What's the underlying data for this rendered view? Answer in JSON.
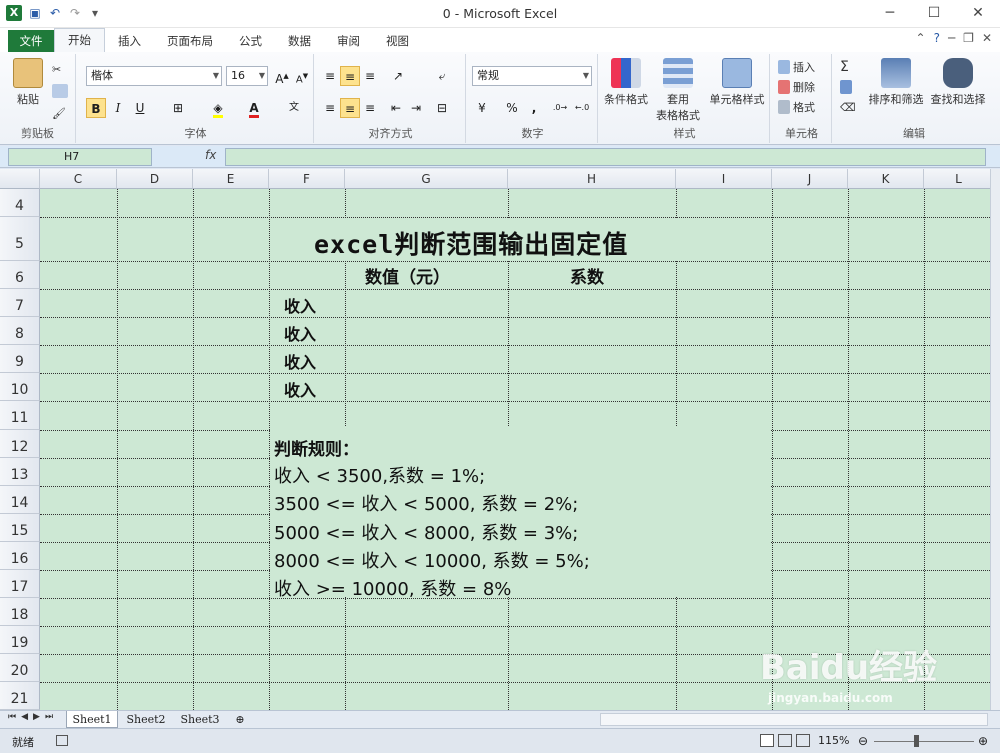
{
  "window": {
    "title": "0  -  Microsoft Excel",
    "controls": [
      "─",
      "☐",
      "✕"
    ]
  },
  "ribbon_tabs": [
    "文件",
    "开始",
    "插入",
    "页面布局",
    "公式",
    "数据",
    "审阅",
    "视图"
  ],
  "ribbon": {
    "clipboard": {
      "paste": "粘贴",
      "label": "剪贴板"
    },
    "font": {
      "name": "楷体",
      "size": "16",
      "label": "字体",
      "bold": "B",
      "italic": "I",
      "underline": "U"
    },
    "alignment": {
      "label": "对齐方式"
    },
    "number": {
      "format": "常规",
      "label": "数字",
      "percent": "%",
      "comma": ","
    },
    "styles": {
      "conditional": "条件格式",
      "table_line1": "套用",
      "table_line2": "表格格式",
      "cell_styles": "单元格样式",
      "label": "样式"
    },
    "cells": {
      "insert": "插入",
      "delete": "删除",
      "format": "格式",
      "label": "单元格"
    },
    "editing": {
      "sort": "排序和筛选",
      "find": "查找和选择",
      "label": "编辑",
      "sum": "Σ"
    }
  },
  "formula_bar": {
    "name_box": "H7",
    "fx": "fx",
    "value": ""
  },
  "columns": [
    "C",
    "D",
    "E",
    "F",
    "G",
    "H",
    "I",
    "J",
    "K",
    "L"
  ],
  "rows": [
    "4",
    "5",
    "6",
    "7",
    "8",
    "9",
    "10",
    "11",
    "12",
    "13",
    "14",
    "15",
    "16",
    "17",
    "18",
    "19",
    "20",
    "21"
  ],
  "sheet": {
    "title": "excel判断范围输出固定值",
    "col_header_value": "数值（元）",
    "col_header_coef": "系数",
    "income_labels": [
      "收入",
      "收入",
      "收入",
      "收入"
    ],
    "rules_title": "判断规则：",
    "rules": [
      "收入 < 3500,系数 = 1%;",
      "3500 <= 收入 < 5000, 系数 = 2%;",
      "5000 <= 收入 < 8000, 系数 = 3%;",
      "8000 <= 收入 < 10000, 系数 = 5%;",
      "收入 >= 10000, 系数 = 8%"
    ]
  },
  "sheet_tabs": [
    "Sheet1",
    "Sheet2",
    "Sheet3"
  ],
  "status": {
    "ready": "就绪",
    "zoom": "115%"
  },
  "watermark": {
    "brand": "Baidu经验",
    "url": "jingyan.baidu.com"
  },
  "colors": {
    "grid_bg": "#cde8d4",
    "file_tab": "#1f7a3a"
  }
}
